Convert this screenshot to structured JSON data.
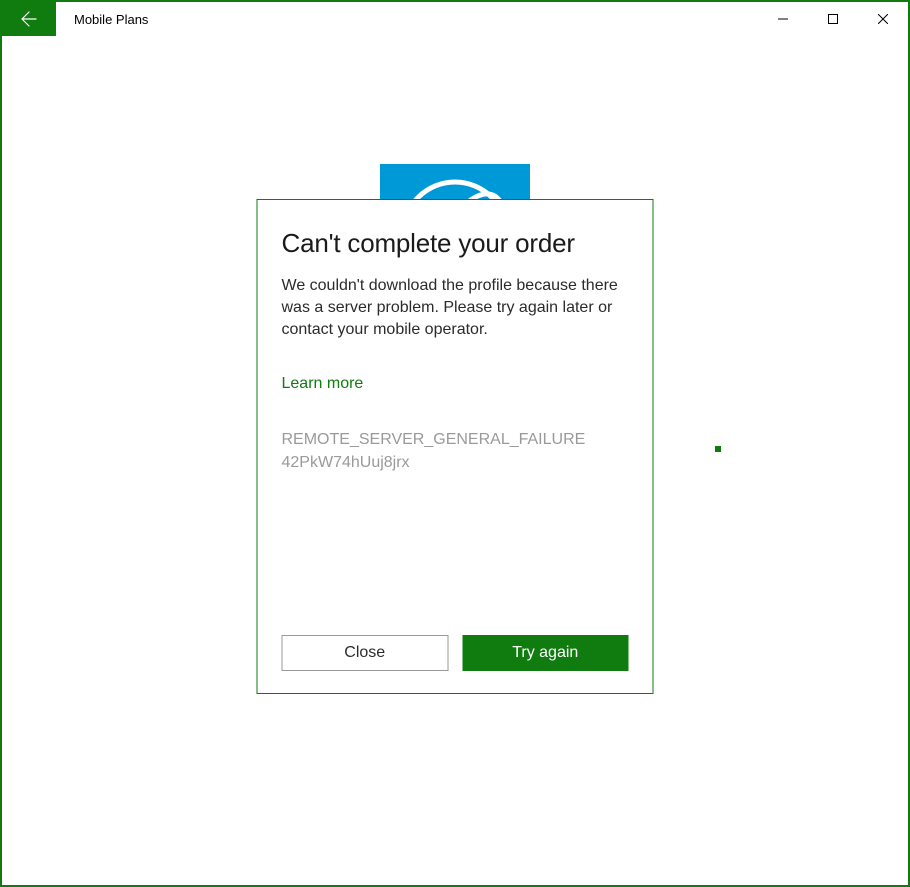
{
  "titlebar": {
    "title": "Mobile Plans"
  },
  "modal": {
    "heading": "Can't complete your order",
    "body": "We couldn't download the profile because there was a server problem. Please try again later or contact your mobile operator.",
    "learn_more": "Learn more",
    "error_line1": "REMOTE_SERVER_GENERAL_FAILURE",
    "error_line2": "42PkW74hUuj8jrx",
    "close_label": "Close",
    "try_again_label": "Try again"
  },
  "colors": {
    "accent": "#107c10",
    "logo_bg": "#0099d8"
  }
}
